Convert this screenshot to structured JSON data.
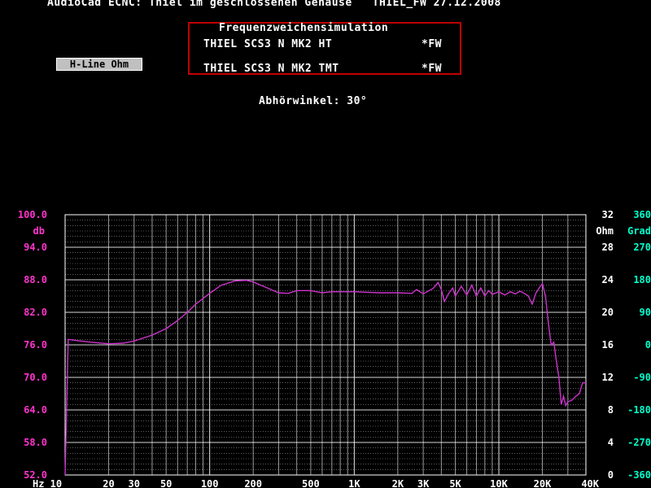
{
  "header": {
    "title": "AudioCad ECNC: Thiel im geschlossenen Gehäuse   THIEL_FW 27.12.2008"
  },
  "info_box": {
    "title": "Frequenzweichensimulation",
    "drivers": [
      {
        "name": "THIEL SCS3 N MK2 HT",
        "tag": "*FW"
      },
      {
        "name": "THIEL SCS3 N MK2 TMT",
        "tag": "*FW"
      }
    ]
  },
  "toolbar": {
    "hline_label": "H-Line Ohm"
  },
  "angle_label": "Abhörwinkel: 30°",
  "colors": {
    "magnitude": "#ff33cc",
    "curve": "#cc33cc",
    "ohm": "#ffffff",
    "grad": "#00ffcc",
    "grid": "#ffffff",
    "box_border": "#c00000"
  },
  "chart_data": {
    "type": "line",
    "xscale": "log",
    "xlim": [
      10,
      40000
    ],
    "x_tick_labels": [
      "Hz 10",
      "20",
      "30",
      "50",
      "100",
      "200",
      "500",
      "1K",
      "2K",
      "3K",
      "5K",
      "10K",
      "20K",
      "40K"
    ],
    "x_tick_values": [
      10,
      20,
      30,
      50,
      100,
      200,
      500,
      1000,
      2000,
      3000,
      5000,
      10000,
      20000,
      40000
    ],
    "ylim": [
      52,
      100
    ],
    "y_ticks_db": [
      "100.0",
      "94.0",
      "88.0",
      "82.0",
      "76.0",
      "70.0",
      "64.0",
      "58.0",
      "52.0"
    ],
    "ylabel": "db",
    "y2_ticks_ohm": [
      "32",
      "28",
      "24",
      "20",
      "16",
      "12",
      "8",
      "4",
      "0"
    ],
    "y2label": "Ohm",
    "y3_ticks_grad": [
      "360",
      "270",
      "180",
      "90",
      "0",
      "-90",
      "-180",
      "-270",
      "-360"
    ],
    "y3label": "Grad",
    "grid": true,
    "series": [
      {
        "x": [
          10,
          10.5,
          12,
          15,
          20,
          25,
          30,
          40,
          50,
          60,
          70,
          80,
          100,
          120,
          150,
          180,
          200,
          250,
          300,
          350,
          400,
          500,
          600,
          700,
          800,
          1000,
          1200,
          1500,
          2000,
          2500,
          2700,
          3000,
          3500,
          3800,
          4000,
          4200,
          4500,
          4800,
          5000,
          5500,
          6000,
          6500,
          7000,
          7500,
          8000,
          8500,
          9000,
          10000,
          11000,
          12000,
          13000,
          14000,
          15000,
          16000,
          17000,
          18000,
          19000,
          20000,
          21000,
          22000,
          23000,
          24000,
          25000,
          26000,
          27000,
          28000,
          29000,
          30000,
          32000,
          34000,
          36000,
          38000,
          40000
        ],
        "y": [
          52.0,
          77.0,
          76.8,
          76.5,
          76.2,
          76.3,
          76.7,
          77.8,
          79.0,
          80.5,
          82.0,
          83.5,
          85.5,
          87.0,
          87.8,
          87.9,
          87.6,
          86.5,
          85.6,
          85.5,
          86.0,
          86.0,
          85.6,
          85.8,
          85.8,
          85.8,
          85.7,
          85.6,
          85.6,
          85.5,
          86.2,
          85.4,
          86.4,
          87.5,
          86.2,
          84.0,
          85.5,
          86.5,
          85.0,
          86.8,
          85.2,
          87.0,
          85.0,
          86.5,
          85.0,
          86.0,
          85.3,
          85.8,
          85.2,
          85.8,
          85.4,
          85.9,
          85.5,
          85.0,
          83.5,
          85.5,
          86.5,
          87.3,
          85.0,
          80.0,
          76.0,
          76.5,
          73.0,
          70.0,
          65.0,
          66.5,
          64.8,
          65.5,
          65.8,
          66.5,
          67.0,
          69.0,
          69.0
        ]
      }
    ]
  }
}
